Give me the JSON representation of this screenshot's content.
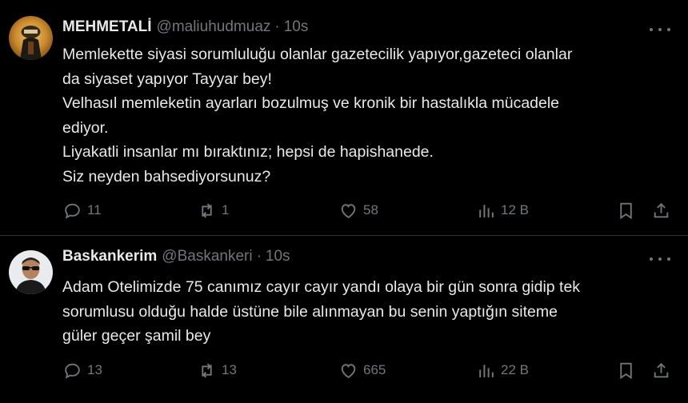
{
  "colors": {
    "background": "#000000",
    "text_primary": "#e7e9ea",
    "text_secondary": "#71767b",
    "divider": "#2f3336"
  },
  "tweets": [
    {
      "display_name": "MEHMETALİ",
      "handle": "@maliuhudmuaz",
      "separator": "·",
      "time": "10s",
      "avatar_icon": "profile-photo-figure-gold",
      "lines": [
        "Memlekette siyasi sorumluluğu olanlar gazetecilik yapıyor,gazeteci olanlar",
        "da siyaset yapıyor Tayyar bey!",
        "Velhasıl memleketin ayarları bozulmuş ve kronik bir hastalıkla mücadele",
        "ediyor.",
        "Liyakatli insanlar mı bıraktınız; hepsi de hapishanede.",
        "Siz neyden bahsediyorsunuz?"
      ],
      "replies": "11",
      "reposts": "1",
      "likes": "58",
      "views": "12 B"
    },
    {
      "display_name": "Baskankerim",
      "handle": "@Baskankeri",
      "separator": "·",
      "time": "10s",
      "avatar_icon": "profile-photo-man-sunglasses",
      "lines": [
        "Adam Otelimizde 75 canımız cayır cayır yandı olaya bir gün sonra gidip tek",
        "sorumlusu olduğu halde üstüne bile alınmayan bu senin yaptığın siteme",
        "güler geçer şamil bey"
      ],
      "replies": "13",
      "reposts": "13",
      "likes": "665",
      "views": "22 B"
    }
  ]
}
